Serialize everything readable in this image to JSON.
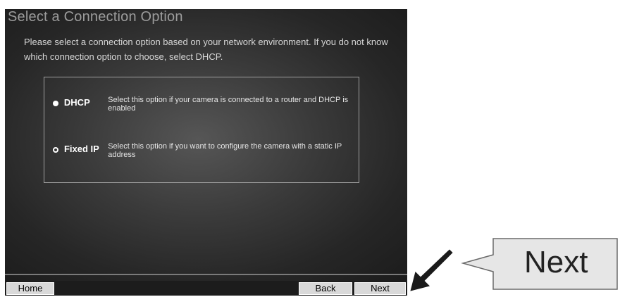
{
  "header": {
    "title": "Select a Connection Option"
  },
  "instructions": "Please select a connection option based on your network environment. If you do not know which connection option to choose, select DHCP.",
  "options": [
    {
      "label": "DHCP",
      "description": "Select this option if your camera is connected to a router and DHCP is enabled",
      "selected": true
    },
    {
      "label": "Fixed IP",
      "description": "Select this option if you want to configure the camera with a static IP address",
      "selected": false
    }
  ],
  "footer": {
    "home_label": "Home",
    "back_label": "Back",
    "next_label": "Next"
  },
  "annotation": {
    "callout_text": "Next",
    "arrow_icon": "pointer-arrow"
  },
  "colors": {
    "panel_bg": "#2e2e2e",
    "title_text": "#9c9c9c",
    "option_text": "#ffffff",
    "button_bg": "#d9d9d9"
  }
}
